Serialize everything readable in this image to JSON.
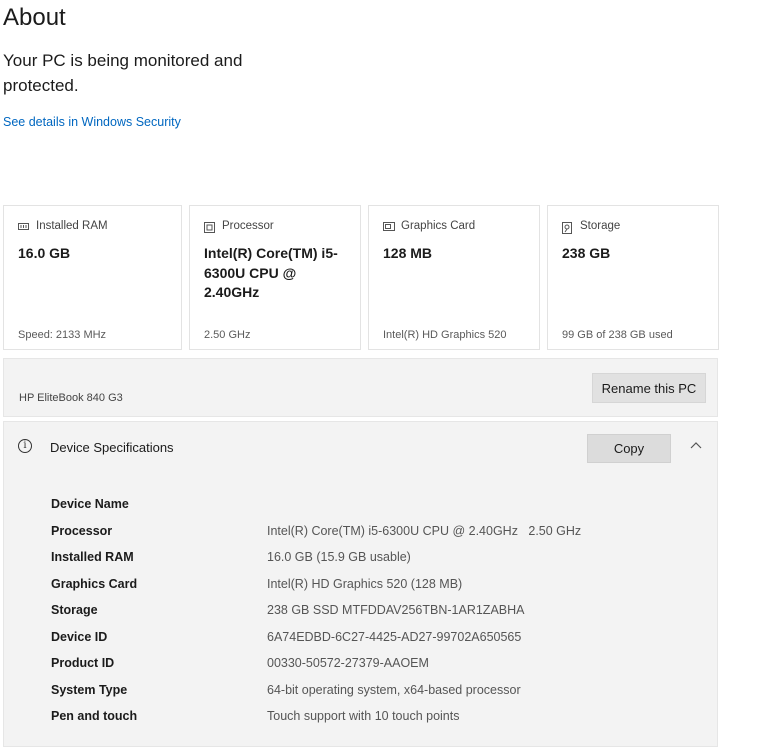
{
  "page": {
    "title": "About",
    "security_status": "Your PC is being monitored and protected.",
    "security_link": "See details in Windows Security"
  },
  "cards": [
    {
      "icon": "ram-icon",
      "label": "Installed RAM",
      "value": "16.0 GB",
      "sub": "Speed: 2133 MHz"
    },
    {
      "icon": "processor-icon",
      "label": "Processor",
      "value": "Intel(R) Core(TM) i5-6300U CPU @ 2.40GHz",
      "sub": "2.50 GHz"
    },
    {
      "icon": "graphics-card-icon",
      "label": "Graphics Card",
      "value": "128 MB",
      "sub": "Intel(R) HD Graphics 520"
    },
    {
      "icon": "storage-icon",
      "label": "Storage",
      "value": "238 GB",
      "sub": "99 GB of 238 GB used"
    }
  ],
  "device": {
    "model": "HP EliteBook 840 G3",
    "rename_label": "Rename this PC"
  },
  "specs": {
    "title": "Device Specifications",
    "copy_label": "Copy",
    "rows": [
      {
        "label": "Device Name",
        "value": ""
      },
      {
        "label": "Processor",
        "value": "Intel(R) Core(TM) i5-6300U CPU @ 2.40GHz   2.50 GHz"
      },
      {
        "label": "Installed RAM",
        "value": "16.0 GB (15.9 GB usable)"
      },
      {
        "label": "Graphics Card",
        "value": "Intel(R) HD Graphics 520 (128 MB)"
      },
      {
        "label": "Storage",
        "value": "238 GB SSD MTFDDAV256TBN-1AR1ZABHA"
      },
      {
        "label": "Device ID",
        "value": "6A74EDBD-6C27-4425-AD27-99702A650565"
      },
      {
        "label": "Product ID",
        "value": "00330-50572-27379-AAOEM"
      },
      {
        "label": "System Type",
        "value": "64-bit operating system, x64-based processor"
      },
      {
        "label": "Pen and touch",
        "value": "Touch support with 10 touch points"
      }
    ]
  },
  "colors": {
    "link": "#0067c0",
    "panel_bg": "#f3f3f3",
    "button_bg": "#e1e1e1"
  }
}
